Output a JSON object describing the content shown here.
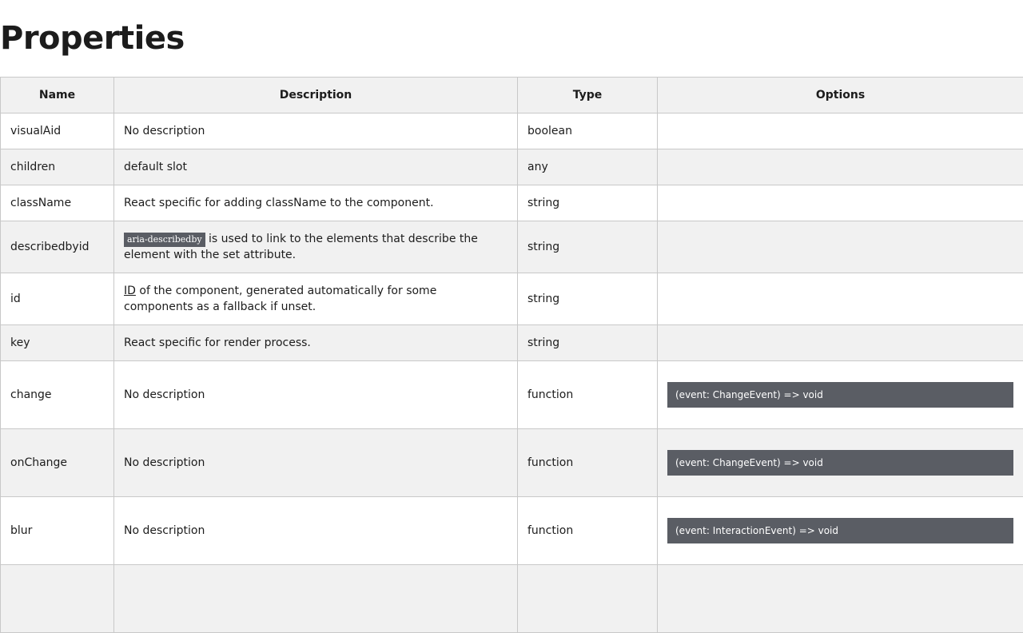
{
  "page": {
    "title": "Properties"
  },
  "table": {
    "headers": [
      "Name",
      "Description",
      "Type",
      "Options"
    ],
    "rows": [
      {
        "name": "visualAid",
        "description": "No description",
        "type": "boolean",
        "option": ""
      },
      {
        "name": "children",
        "description": "default slot",
        "type": "any",
        "option": ""
      },
      {
        "name": "className",
        "description": "React specific for adding className to the component.",
        "type": "string",
        "option": ""
      },
      {
        "name": "describedbyid",
        "description_code": "aria-describedby",
        "description": "is used to link to the elements that describe the element with the set attribute.",
        "type": "string",
        "option": ""
      },
      {
        "name": "id",
        "description_abbr": "ID",
        "description": "of the component, generated automatically for some components as a fallback if unset.",
        "type": "string",
        "option": ""
      },
      {
        "name": "key",
        "description": "React specific for render process.",
        "type": "string",
        "option": ""
      },
      {
        "name": "change",
        "description": "No description",
        "type": "function",
        "option": "(event: ChangeEvent) => void"
      },
      {
        "name": "onChange",
        "description": "No description",
        "type": "function",
        "option": "(event: ChangeEvent) => void"
      },
      {
        "name": "blur",
        "description": "No description",
        "type": "function",
        "option": "(event: InteractionEvent) => void"
      }
    ]
  },
  "colors": {
    "header_bg": "#f1f1f1",
    "border": "#c8c8c8",
    "code_bg": "#5a5d64",
    "text": "#1c1c1c"
  }
}
